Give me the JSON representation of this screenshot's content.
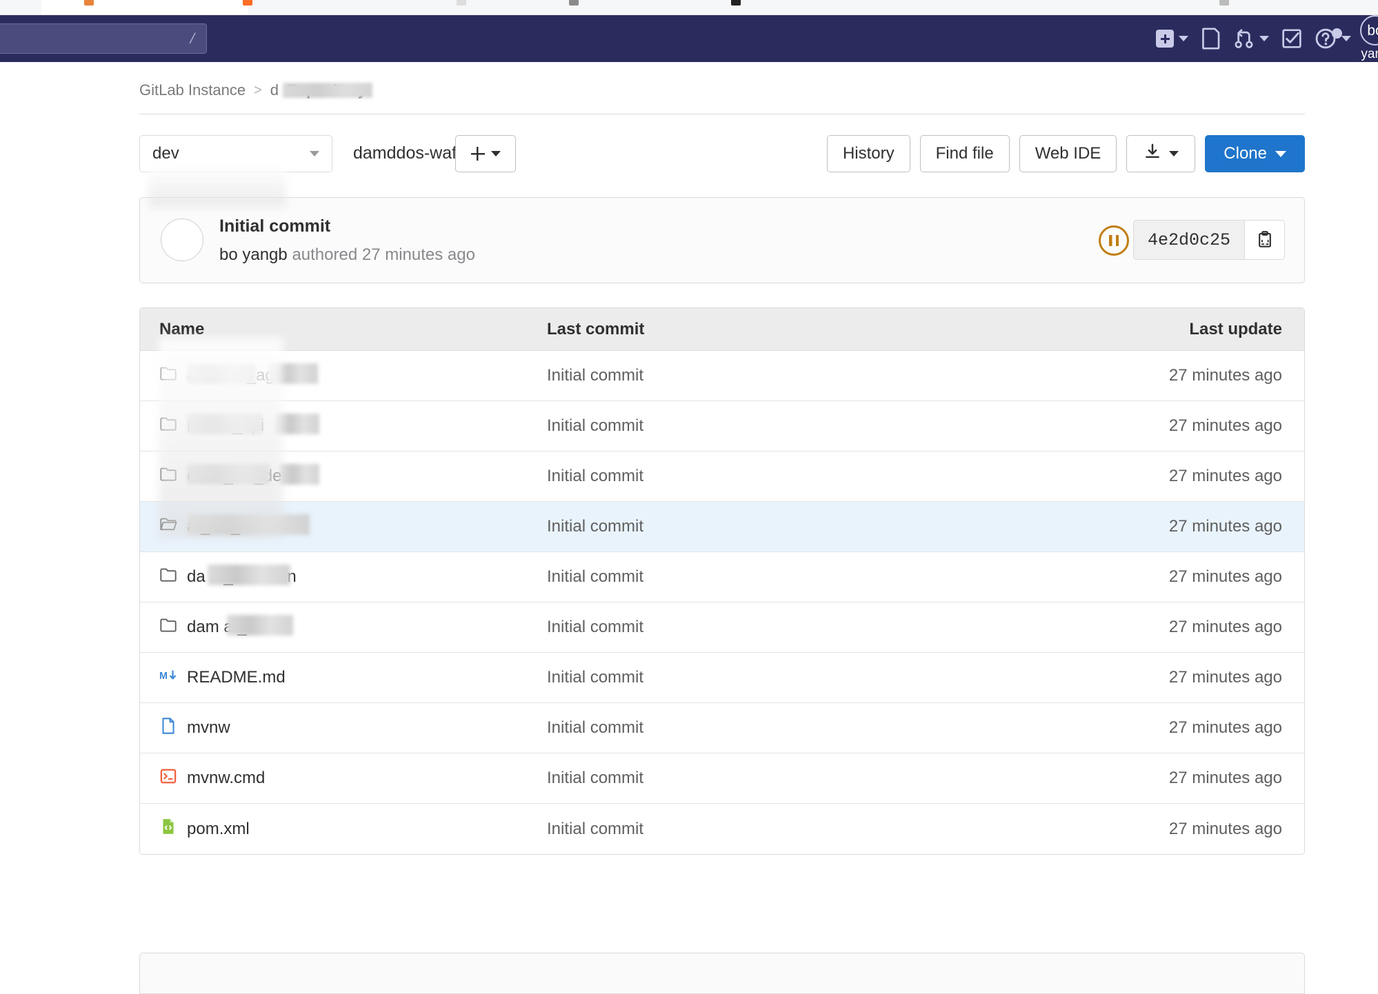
{
  "navbar": {
    "search_shortcut": "/",
    "items": [
      {
        "name": "new-dropdown",
        "icon": "plus-square-icon",
        "has_caret": true
      },
      {
        "name": "issues",
        "icon": "issues-icon",
        "has_caret": false
      },
      {
        "name": "merge-requests",
        "icon": "merge-request-icon",
        "has_caret": true
      },
      {
        "name": "todos",
        "icon": "todo-check-icon",
        "has_caret": false
      },
      {
        "name": "help",
        "icon": "question-circle-icon",
        "has_caret": true
      }
    ],
    "avatar_initials": "bo",
    "avatar_name": "yang"
  },
  "breadcrumb": {
    "root": "GitLab Instance",
    "separator": ">",
    "project_prefix": "d",
    "current": "Repository"
  },
  "toolbar": {
    "branch": "dev",
    "path": "damddos-waf",
    "path_separator": "/",
    "add_label": "+",
    "history_label": "History",
    "find_file_label": "Find file",
    "web_ide_label": "Web IDE",
    "download_label": "",
    "clone_label": "Clone"
  },
  "commit": {
    "title": "Initial commit",
    "author": "bo yangb",
    "meta_suffix": "authored 27 minutes ago",
    "pipeline_status": "pending",
    "sha": "4e2d0c25"
  },
  "table": {
    "headers": {
      "name": "Name",
      "last_commit": "Last commit",
      "last_update": "Last update"
    },
    "rows": [
      {
        "name": "amdd      af_agent",
        "icon": "folder-icon",
        "type": "folder",
        "redacted": true,
        "redact_spans": [
          [
            0,
            100
          ],
          [
            118,
            72
          ]
        ],
        "last_commit": "Initial commit",
        "last_update": "27 minutes ago",
        "selected": false
      },
      {
        "name": "ndd      af_api",
        "icon": "folder-icon",
        "type": "folder",
        "redacted": true,
        "redact_spans": [
          [
            0,
            110
          ],
          [
            128,
            64
          ]
        ],
        "last_commit": "Initial commit",
        "last_update": "27 minutes ago",
        "selected": false
      },
      {
        "name": "dd      af_biz_device",
        "icon": "folder-icon",
        "type": "folder",
        "redacted": true,
        "redact_spans": [
          [
            0,
            120
          ],
          [
            134,
            58
          ]
        ],
        "last_commit": "Initial commit",
        "last_update": "27 minutes ago",
        "selected": false
      },
      {
        "name": "af_biz_mod",
        "icon": "folder-open-icon",
        "type": "folder",
        "redacted": true,
        "redact_spans": [
          [
            0,
            178
          ]
        ],
        "last_commit": "Initial commit",
        "last_update": "27 minutes ago",
        "selected": true
      },
      {
        "name": "da      af_common",
        "icon": "folder-icon",
        "type": "folder",
        "redacted": true,
        "redact_spans": [
          [
            30,
            120
          ]
        ],
        "last_commit": "Initial commit",
        "last_update": "27 minutes ago",
        "selected": false
      },
      {
        "name": "dam      af_web",
        "icon": "folder-icon",
        "type": "folder",
        "redacted": true,
        "redact_spans": [
          [
            58,
            96
          ]
        ],
        "last_commit": "Initial commit",
        "last_update": "27 minutes ago",
        "selected": false
      },
      {
        "name": "README.md",
        "icon": "markdown-icon",
        "type": "file",
        "redacted": false,
        "redact_spans": [],
        "last_commit": "Initial commit",
        "last_update": "27 minutes ago",
        "selected": false
      },
      {
        "name": "mvnw",
        "icon": "file-icon",
        "type": "file",
        "redacted": false,
        "redact_spans": [],
        "last_commit": "Initial commit",
        "last_update": "27 minutes ago",
        "selected": false
      },
      {
        "name": "mvnw.cmd",
        "icon": "console-icon",
        "type": "file",
        "redacted": false,
        "redact_spans": [],
        "last_commit": "Initial commit",
        "last_update": "27 minutes ago",
        "selected": false
      },
      {
        "name": "pom.xml",
        "icon": "xml-code-icon",
        "type": "file",
        "redacted": false,
        "redact_spans": [],
        "last_commit": "Initial commit",
        "last_update": "27 minutes ago",
        "selected": false
      }
    ]
  },
  "colors": {
    "navbar_bg": "#2b2c5e",
    "clone_blue": "#1f75cb",
    "pipeline_orange": "#c17d10",
    "selected_row": "#e9f3fc",
    "markdown_blue": "#3c87d6",
    "console_orange": "#f4603e",
    "xml_green": "#8cc63f"
  }
}
